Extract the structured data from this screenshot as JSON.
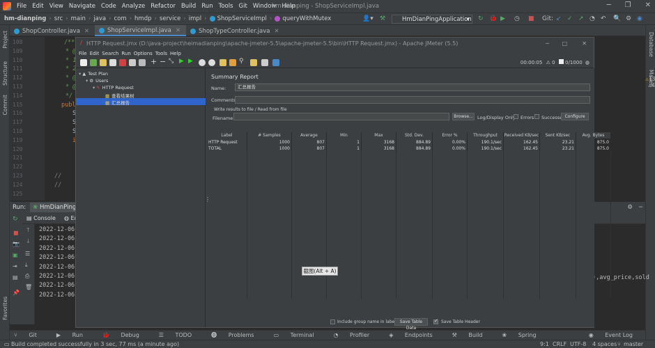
{
  "ide": {
    "menu": [
      "File",
      "Edit",
      "View",
      "Navigate",
      "Code",
      "Analyze",
      "Refactor",
      "Build",
      "Run",
      "Tools",
      "Git",
      "Window",
      "Help"
    ],
    "window_title": "hm-dianping - ShopServiceImpl.java",
    "breadcrumbs": [
      "hm-dianping",
      "src",
      "main",
      "java",
      "com",
      "hmdp",
      "service",
      "impl",
      "ShopServiceImpl",
      "queryWithMutex"
    ],
    "run_config": "HmDianPingApplication",
    "git_label": "Git:",
    "tabs": [
      {
        "label": "ShopController.java",
        "active": false
      },
      {
        "label": "ShopServiceImpl.java",
        "active": true
      },
      {
        "label": "ShopTypeController.java",
        "active": false
      }
    ],
    "line_numbers": [
      "108",
      "109",
      "110",
      "111",
      "112",
      "113",
      "114",
      "115",
      "116",
      "117",
      "118",
      "119",
      "120",
      "121",
      "122",
      "123",
      "124",
      "125"
    ],
    "code_lines": [
      "/**",
      "* @",
      "* 1.",
      "* 2.",
      "* @p",
      "* @r",
      "*/",
      "publ",
      "S",
      "S",
      "S",
      "i",
      "",
      "",
      "",
      "//",
      "//",
      ""
    ],
    "inspection": {
      "warnings": "13",
      "weak": "4"
    },
    "left_tools": [
      "Project",
      "Structure",
      "Commit",
      "Favorites"
    ],
    "right_tools": [
      "Database",
      "Maven"
    ],
    "run_label": "Run:",
    "run_tab": "HmDianPingAp",
    "console_tabs": [
      "Console",
      "End"
    ],
    "console_lines": [
      "2022-12-06",
      "2022-12-06",
      "2022-12-06",
      "2022-12-06",
      "2022-12-06",
      "2022-12-06",
      "2022-12-06",
      "2022-12-06"
    ],
    "console_right_text": "),avg_price,sold",
    "bottom_tools": [
      "Git",
      "Run",
      "Debug",
      "TODO",
      "Problems",
      "Terminal",
      "Profiler",
      "Endpoints",
      "Build",
      "Spring"
    ],
    "event_log": "Event Log",
    "status_message": "Build completed successfully in 3 sec, 77 ms (a minute ago)",
    "status_right": [
      "9:1",
      "CRLF",
      "UTF-8",
      "4 spaces",
      "master"
    ]
  },
  "jmeter": {
    "title": "HTTP Request.jmx (D:\\java-project\\heimadianping\\apache-jmeter-5.5\\apache-jmeter-5.5\\bin\\HTTP Request.jmx) - Apache JMeter (5.5)",
    "menu": [
      "File",
      "Edit",
      "Search",
      "Run",
      "Options",
      "Tools",
      "Help"
    ],
    "timer": "00:00:05",
    "counter": "0/1000",
    "tree": [
      {
        "label": "Test Plan",
        "level": 0
      },
      {
        "label": "Users",
        "level": 1
      },
      {
        "label": "HTTP Request",
        "level": 2
      },
      {
        "label": "查看结果树",
        "level": 3
      },
      {
        "label": "汇总报告",
        "level": 3,
        "selected": true
      }
    ],
    "panel_title": "Summary Report",
    "name_label": "Name:",
    "name_value": "汇总报告",
    "comments_label": "Comments:",
    "write_label": "Write results to file / Read from file",
    "filename_label": "Filename",
    "browse_btn": "Browse...",
    "log_display": "Log/Display Only:",
    "errors_label": "Errors",
    "successes_label": "Successes",
    "configure_btn": "Configure",
    "table": {
      "headers": [
        "Label",
        "# Samples",
        "Average",
        "Min",
        "Max",
        "Std. Dev.",
        "Error %",
        "Throughput",
        "Received KB/sec",
        "Sent KB/sec",
        "Avg. Bytes"
      ],
      "rows": [
        [
          "HTTP Request",
          "1000",
          "807",
          "1",
          "3168",
          "884.89",
          "0.00%",
          "190.1/sec",
          "162.45",
          "23.21",
          "875.0"
        ],
        [
          "TOTAL",
          "1000",
          "807",
          "1",
          "3168",
          "884.89",
          "0.00%",
          "190.1/sec",
          "162.45",
          "23.21",
          "875.0"
        ]
      ]
    },
    "include_group": "Include group name in label?",
    "save_table_data": "Save Table Data",
    "save_table_header": "Save Table Header"
  },
  "tooltip": "截图(Alt + A)"
}
